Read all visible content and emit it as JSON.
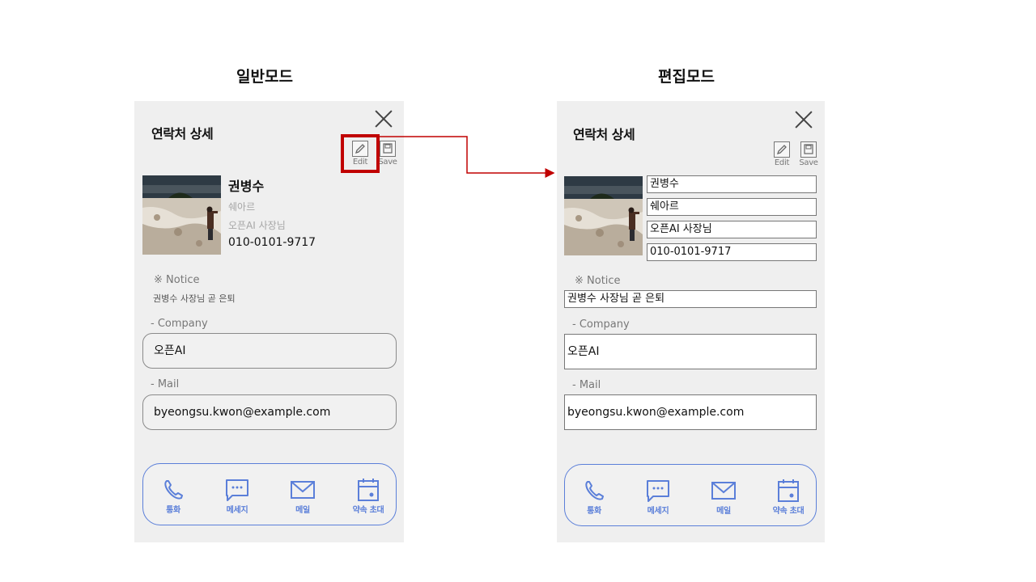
{
  "modes": {
    "normal": "일반모드",
    "edit": "편집모드"
  },
  "panel_title": "연락처 상세",
  "toolbar": {
    "edit_label": "Edit",
    "save_label": "Save"
  },
  "contact": {
    "name": "권병수",
    "nickname": "쉐아르",
    "title": "오픈AI 사장님",
    "phone": "010-0101-9717",
    "notice_label": "※ Notice",
    "notice": "권병수 사장님 곧 은퇴",
    "company_label": "- Company",
    "company": "오픈AI",
    "mail_label": "- Mail",
    "mail": "byeongsu.kwon@example.com"
  },
  "actions": [
    {
      "label": "통화",
      "icon": "phone-icon"
    },
    {
      "label": "메세지",
      "icon": "message-icon"
    },
    {
      "label": "메일",
      "icon": "mail-icon"
    },
    {
      "label": "약속 초대",
      "icon": "calendar-icon"
    }
  ],
  "colors": {
    "accent": "#5b7fd9",
    "highlight": "#c00000",
    "panel_bg": "#efefef"
  }
}
